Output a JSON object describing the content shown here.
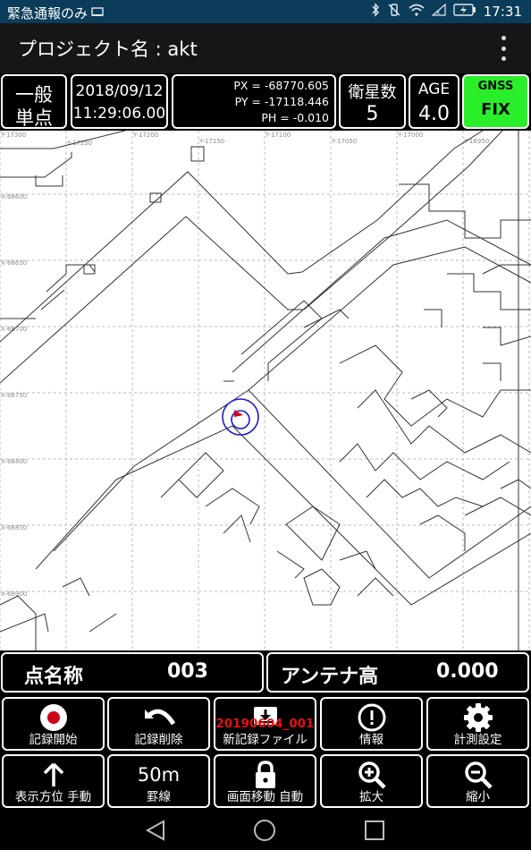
{
  "status_bar": {
    "left_text": "緊急通報のみ",
    "time": "17:31",
    "icons": [
      "sim-icon",
      "bluetooth-icon",
      "vibrate-icon",
      "wifi-icon",
      "no-signal-icon",
      "battery-icon"
    ]
  },
  "app_bar": {
    "title": "プロジェクト名 : akt"
  },
  "info": {
    "mode_line1": "一般",
    "mode_line2": "単点",
    "date": "2018/09/12",
    "time": "11:29:06.00",
    "px": "PX = -68770.605",
    "py": "PY = -17118.446",
    "ph": "PH = -0.010",
    "sats_label": "衛星数",
    "sats_value": "5",
    "age_label": "AGE",
    "age_value": "4.0",
    "gnss_label": "GNSS",
    "gnss_value": "FIX"
  },
  "map": {
    "y_labels": [
      "Y-17300",
      "Y-17250",
      "Y-17200",
      "Y-17150",
      "Y-17100",
      "Y-17050",
      "Y-17000",
      "Y-16950"
    ],
    "x_labels": [
      "X-68600",
      "X-68650",
      "X-68700",
      "X-68750",
      "X-68800",
      "X-68850",
      "X-68900"
    ]
  },
  "point": {
    "label": "点名称",
    "value": "003"
  },
  "antenna": {
    "label": "アンテナ高",
    "value": "0.000"
  },
  "buttons_row1": [
    {
      "label": "記録開始",
      "icon": "record-icon"
    },
    {
      "label": "記録削除",
      "icon": "undo-icon"
    },
    {
      "label": "新記録ファイル",
      "icon": "file-download-icon",
      "filename": "20190604_001"
    },
    {
      "label": "情報",
      "icon": "info-icon"
    },
    {
      "label": "計測設定",
      "icon": "gear-icon"
    }
  ],
  "buttons_row2": [
    {
      "label": "表示方位 手動",
      "icon": "arrow-up-icon"
    },
    {
      "label": "罫線",
      "icon_text": "50m"
    },
    {
      "label": "画面移動 自動",
      "icon": "lock-icon"
    },
    {
      "label": "拡大",
      "icon": "zoom-in-icon"
    },
    {
      "label": "縮小",
      "icon": "zoom-out-icon"
    }
  ],
  "colors": {
    "status_bar": "#0b3c5a",
    "gnss_fix": "#2aee2a",
    "record_red": "#d0021b",
    "filename_red": "#e81010",
    "position_marker": "#1a1acc"
  }
}
